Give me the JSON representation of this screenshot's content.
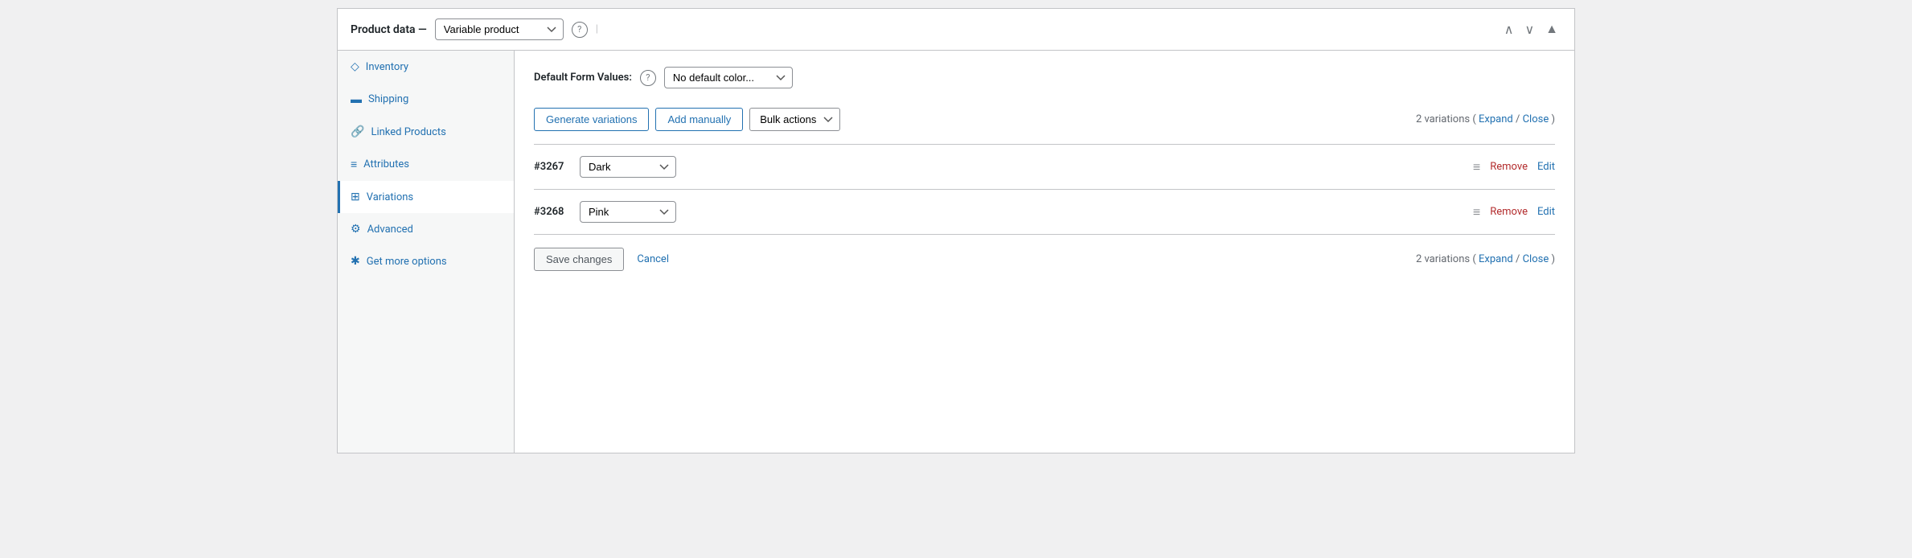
{
  "panel": {
    "title": "Product data —",
    "title_separator": "—",
    "product_type_label": "Variable product",
    "help_icon_label": "?",
    "chevrons": [
      "∧",
      "∨",
      "▲"
    ]
  },
  "sidebar": {
    "items": [
      {
        "id": "inventory",
        "label": "Inventory",
        "icon": "◇"
      },
      {
        "id": "shipping",
        "label": "Shipping",
        "icon": "▬"
      },
      {
        "id": "linked-products",
        "label": "Linked Products",
        "icon": "🔗"
      },
      {
        "id": "attributes",
        "label": "Attributes",
        "icon": "≡"
      },
      {
        "id": "variations",
        "label": "Variations",
        "icon": "⊞",
        "active": true
      },
      {
        "id": "advanced",
        "label": "Advanced",
        "icon": "⚙"
      },
      {
        "id": "get-more-options",
        "label": "Get more options",
        "icon": "✱"
      }
    ]
  },
  "main": {
    "default_form_label": "Default Form Values:",
    "default_color_placeholder": "No default color...",
    "buttons": {
      "generate_variations": "Generate variations",
      "add_manually": "Add manually",
      "bulk_actions": "Bulk actions"
    },
    "variations_count": "2 variations",
    "expand_label": "Expand",
    "close_label": "Close",
    "variations": [
      {
        "id": "#3267",
        "color": "Dark"
      },
      {
        "id": "#3268",
        "color": "Pink"
      }
    ],
    "footer": {
      "save_label": "Save changes",
      "cancel_label": "Cancel"
    }
  }
}
